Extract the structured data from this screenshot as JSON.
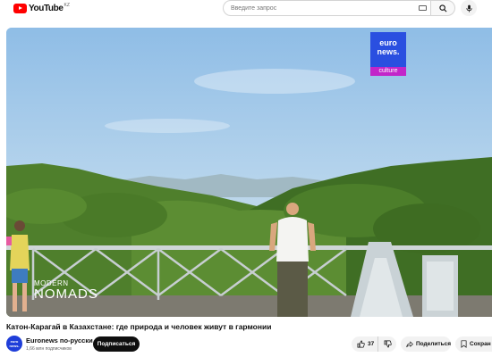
{
  "header": {
    "logo_text": "YouTube",
    "region_code": "KZ",
    "search_placeholder": "Введите запрос",
    "icons": [
      "youtube-logo",
      "keyboard-icon",
      "search-icon",
      "mic-icon"
    ]
  },
  "video": {
    "brand_line1": "euro",
    "brand_line2": "news.",
    "brand_category": "culture",
    "show_line1": "MODERN",
    "show_line2": "NOMADS",
    "colors": {
      "brand_blue": "#2a4fe0",
      "culture_magenta": "#c225c9"
    }
  },
  "info": {
    "title": "Катон-Карагай в Казахстане: где природа и человек живут в гармонии",
    "channel_name": "Euronews по-русски",
    "channel_avatar_line1": "euro",
    "channel_avatar_line2": "news.",
    "subscribers": "1,66 млн подписчиков",
    "subscribe_label": "Подписаться",
    "like_count": "37",
    "share_label": "Поделиться",
    "save_label": "Сохран"
  }
}
